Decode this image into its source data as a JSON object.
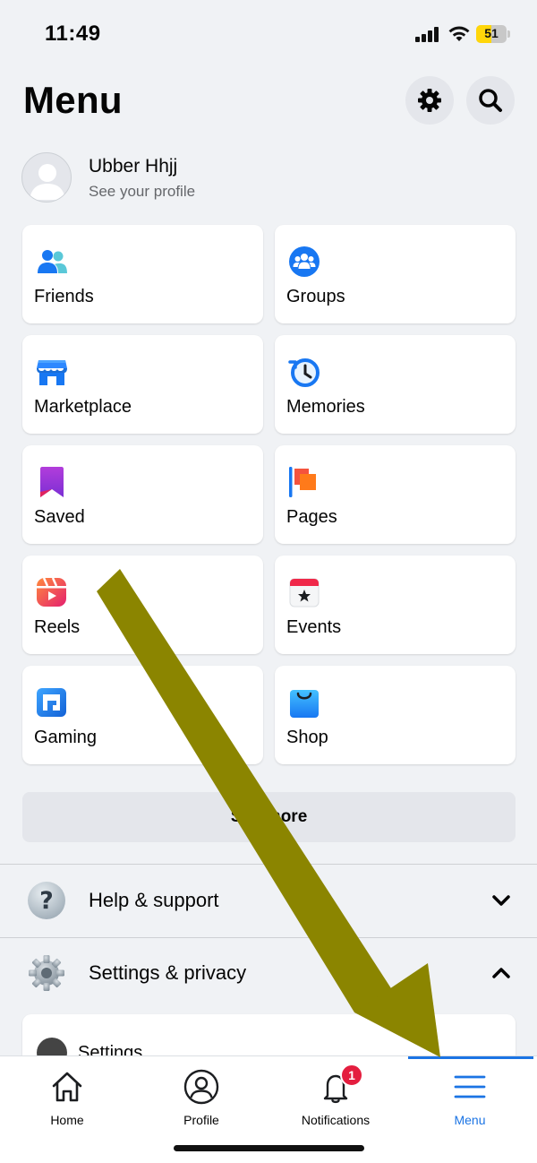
{
  "status_bar": {
    "time": "11:49",
    "battery": "51",
    "battery_level": 0.51,
    "battery_color": "#ffd60a"
  },
  "header": {
    "title": "Menu",
    "settings_icon": "gear-icon",
    "search_icon": "search-icon"
  },
  "profile": {
    "name": "Ubber Hhjj",
    "subtitle": "See your profile"
  },
  "shortcuts": [
    {
      "label": "Friends",
      "icon": "friends-icon"
    },
    {
      "label": "Groups",
      "icon": "groups-icon"
    },
    {
      "label": "Marketplace",
      "icon": "marketplace-icon"
    },
    {
      "label": "Memories",
      "icon": "memories-icon"
    },
    {
      "label": "Saved",
      "icon": "saved-icon"
    },
    {
      "label": "Pages",
      "icon": "pages-icon"
    },
    {
      "label": "Reels",
      "icon": "reels-icon"
    },
    {
      "label": "Events",
      "icon": "events-icon"
    },
    {
      "label": "Gaming",
      "icon": "gaming-icon"
    },
    {
      "label": "Shop",
      "icon": "shop-icon"
    }
  ],
  "see_more": "See more",
  "sections": [
    {
      "label": "Help & support",
      "icon": "question-icon",
      "expanded": false
    },
    {
      "label": "Settings & privacy",
      "icon": "gear-icon",
      "expanded": true
    }
  ],
  "settings_item": "Settings",
  "bottom_nav": [
    {
      "label": "Home",
      "icon": "home-icon"
    },
    {
      "label": "Profile",
      "icon": "profile-icon"
    },
    {
      "label": "Notifications",
      "icon": "bell-icon",
      "badge": "1"
    },
    {
      "label": "Menu",
      "icon": "menu-icon",
      "active": true
    }
  ],
  "colors": {
    "accent": "#1b74e4",
    "background": "#f0f2f5",
    "badge": "#e41e3f",
    "annotation_arrow": "#8b8500"
  }
}
